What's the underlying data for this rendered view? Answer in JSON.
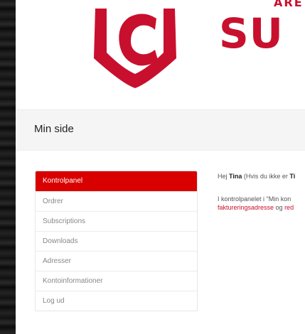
{
  "brand": {
    "wordmark": "SU",
    "wordmark_top": "ÅRE",
    "color": "#c8102e"
  },
  "page": {
    "title": "Min side"
  },
  "nav": {
    "active_color": "#d90000",
    "items": [
      {
        "label": "Kontrolpanel",
        "active": true
      },
      {
        "label": "Ordrer"
      },
      {
        "label": "Subscriptions"
      },
      {
        "label": "Downloads"
      },
      {
        "label": "Adresser"
      },
      {
        "label": "Kontoinformationer"
      },
      {
        "label": "Log ud"
      }
    ]
  },
  "content": {
    "greeting_prefix": "Hej ",
    "greeting_name": "Tina",
    "greeting_suffix": " (Hvis du ikke er ",
    "greeting_name_2": "Ti",
    "intro_prefix": "I kontrolpanelet i \"Min kon",
    "billing_link": "faktureringsadresse",
    "intro_mid": " og ",
    "edit_link": "red"
  }
}
